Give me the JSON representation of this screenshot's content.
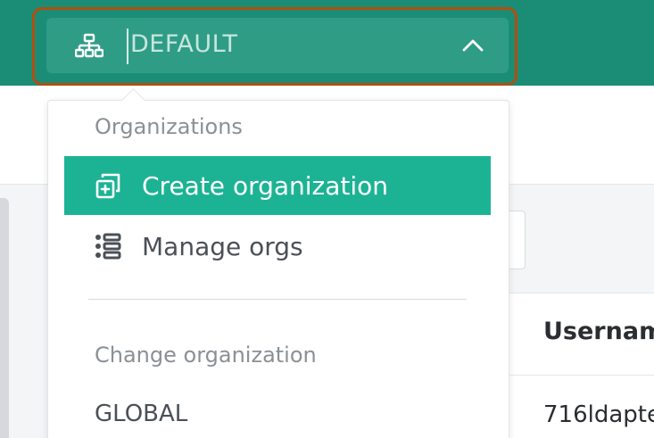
{
  "header": {
    "org_selector": {
      "placeholder": "DEFAULT",
      "icon": "sitemap-icon",
      "toggle_icon": "chevron-up-icon"
    }
  },
  "dropdown": {
    "organizations_heading": "Organizations",
    "items": [
      {
        "label": "Create organization",
        "icon": "create-org-icon"
      },
      {
        "label": "Manage orgs",
        "icon": "list-icon"
      }
    ],
    "change_org_heading": "Change organization",
    "orgs": [
      "GLOBAL"
    ]
  },
  "background_table": {
    "column_header": "Usernam",
    "first_cell": "716ldapte"
  },
  "colors": {
    "header_bg": "#1b8d76",
    "selector_bg": "#2f9c86",
    "focus_ring": "#b24e0f",
    "active_item_bg": "#1cb394"
  }
}
